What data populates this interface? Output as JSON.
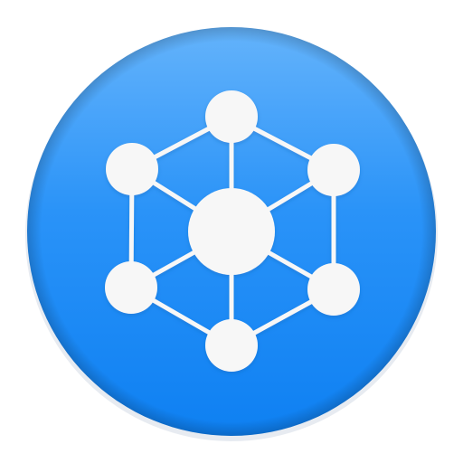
{
  "icon": {
    "name": "network-graph-app-icon",
    "depicts": "network-graph-icon",
    "node_count": 7,
    "edge_count": 12
  },
  "colors": {
    "background": "#ffffff",
    "badge_top": "#64b3fb",
    "badge_mid": "#2a93f8",
    "badge_bottom": "#0e80f2",
    "badge_rim_shadow": "#b9c7d6",
    "foreground": "#f7f7f7",
    "node_shadow": "#1463b3"
  }
}
